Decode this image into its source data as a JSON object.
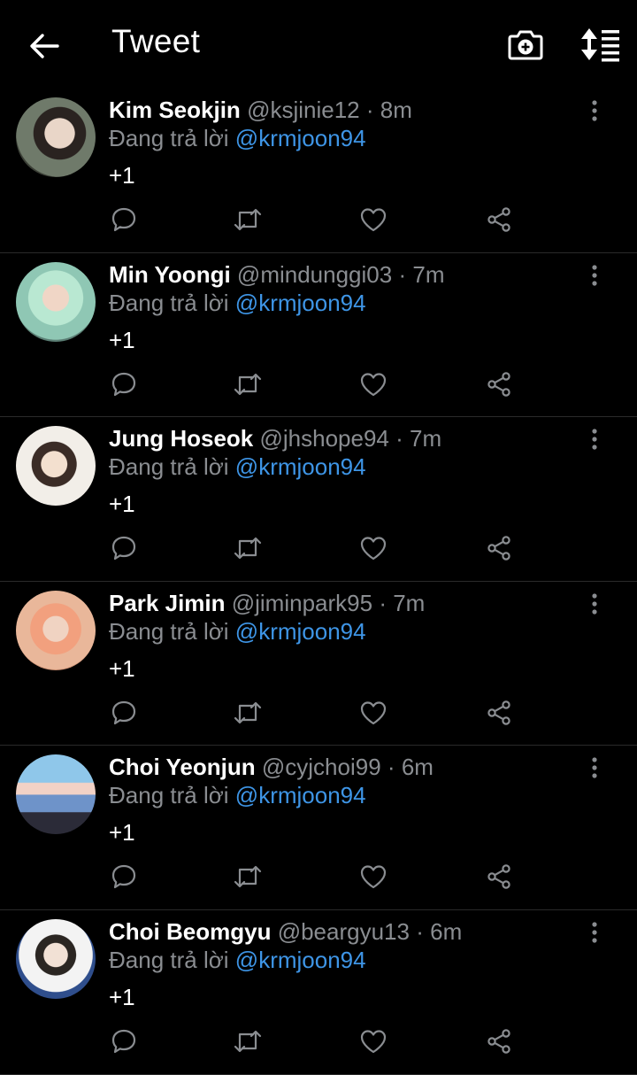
{
  "header": {
    "title": "Tweet",
    "back_icon": "arrow-left-icon",
    "camera_icon": "camera-add-icon",
    "sort_icon": "sort-list-icon"
  },
  "colors": {
    "background": "#000000",
    "text": "#ffffff",
    "muted": "#8a8d91",
    "link": "#3e95e6",
    "divider": "#2a2a2a"
  },
  "tweets": [
    {
      "name": "Kim Seokjin",
      "handle": "@ksjinie12",
      "time": "8m",
      "reply_prefix": "Đang trả lời",
      "reply_to": "@krmjoon94",
      "text": "+1"
    },
    {
      "name": "Min Yoongi",
      "handle": "@mindunggi03",
      "time": "7m",
      "reply_prefix": "Đang trả lời",
      "reply_to": "@krmjoon94",
      "text": "+1"
    },
    {
      "name": "Jung Hoseok",
      "handle": "@jhshope94",
      "time": "7m",
      "reply_prefix": "Đang trả lời",
      "reply_to": "@krmjoon94",
      "text": "+1"
    },
    {
      "name": "Park Jimin ",
      "handle": "@jiminpark95",
      "time": "7m",
      "reply_prefix": "Đang trả lời",
      "reply_to": "@krmjoon94",
      "text": "+1"
    },
    {
      "name": "Choi Yeonjun",
      "handle": "@cyjchoi99",
      "time": "6m",
      "reply_prefix": "Đang trả lời",
      "reply_to": "@krmjoon94",
      "text": "+1"
    },
    {
      "name": "Choi Beomgyu",
      "handle": "@beargyu13",
      "time": "6m",
      "reply_prefix": "Đang trả lời",
      "reply_to": "@krmjoon94",
      "text": "+1"
    }
  ],
  "separator": "·"
}
